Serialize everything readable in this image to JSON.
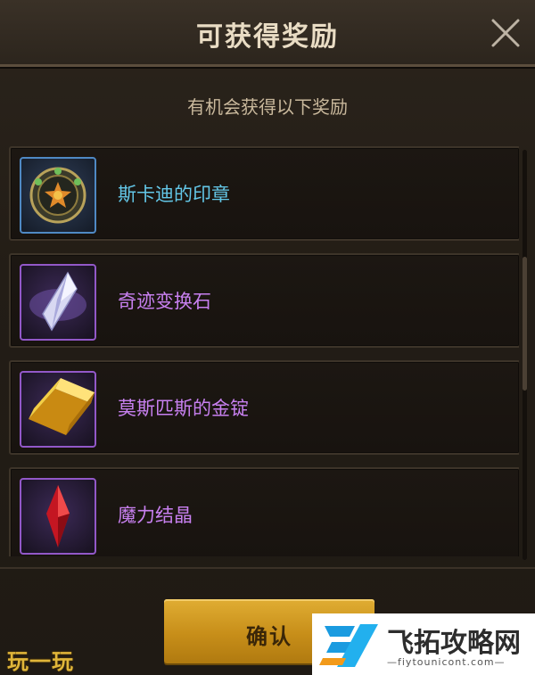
{
  "dialog": {
    "title": "可获得奖励",
    "subtitle": "有机会获得以下奖励",
    "close_icon": "close-icon"
  },
  "rewards": [
    {
      "name": "斯卡迪的印章",
      "icon": "seal-emblem-icon",
      "rarity_color": "#63c7e8"
    },
    {
      "name": "奇迹变换石",
      "icon": "crystal-stone-icon",
      "rarity_color": "#c880f0"
    },
    {
      "name": "莫斯匹斯的金锭",
      "icon": "gold-ingot-icon",
      "rarity_color": "#c880f0"
    },
    {
      "name": "魔力结晶",
      "icon": "red-crystal-icon",
      "rarity_color": "#c880f0"
    }
  ],
  "footer": {
    "confirm_label": "确认"
  },
  "watermarks": {
    "left_text": "玩一玩",
    "right_name": "飞拓攻略网",
    "right_url": "—fiytounicont.com—"
  },
  "colors": {
    "accent_gold": "#c78e19",
    "blue_rarity": "#63c7e8",
    "purple_rarity": "#c880f0"
  }
}
